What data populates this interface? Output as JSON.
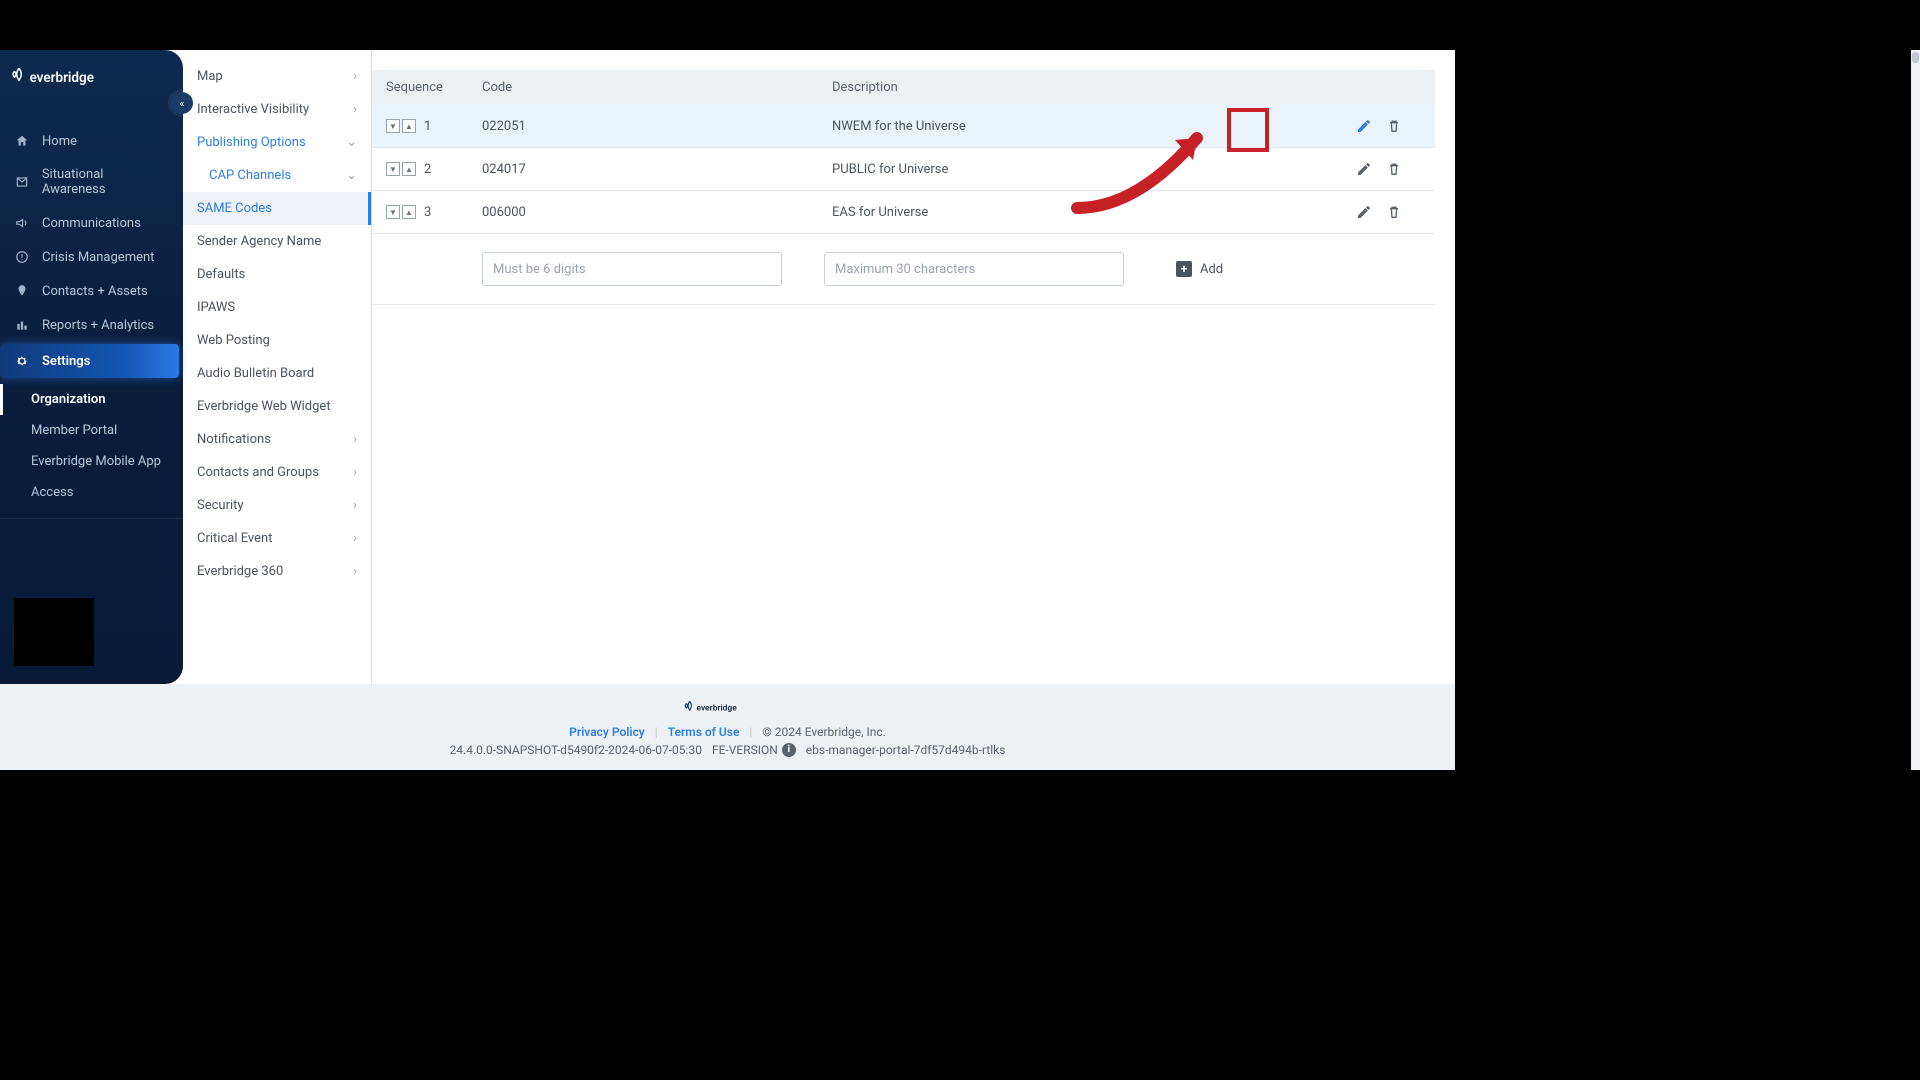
{
  "brand": "everbridge",
  "sidebar": {
    "items": [
      {
        "label": "Home"
      },
      {
        "label": "Situational Awareness"
      },
      {
        "label": "Communications"
      },
      {
        "label": "Crisis Management"
      },
      {
        "label": "Contacts + Assets"
      },
      {
        "label": "Reports + Analytics"
      },
      {
        "label": "Settings"
      }
    ],
    "sub": [
      {
        "label": "Organization"
      },
      {
        "label": "Member Portal"
      },
      {
        "label": "Everbridge Mobile App"
      },
      {
        "label": "Access"
      }
    ]
  },
  "sidebar2": {
    "items": [
      {
        "label": "Map",
        "expand": "right"
      },
      {
        "label": "Interactive Visibility",
        "expand": "right"
      },
      {
        "label": "Publishing Options",
        "expand": "down",
        "sel": true
      },
      {
        "label": "CAP Channels",
        "expand": "down",
        "sel": true,
        "indent": 1
      },
      {
        "label": "SAME Codes",
        "leaf": true,
        "active": true,
        "indent": 2
      },
      {
        "label": "Sender Agency Name",
        "leaf": true,
        "indent": 2
      },
      {
        "label": "Defaults",
        "leaf": true,
        "indent": 2
      },
      {
        "label": "IPAWS",
        "leaf": true,
        "indent": 2
      },
      {
        "label": "Web Posting",
        "leaf": true,
        "indent": 1
      },
      {
        "label": "Audio Bulletin Board",
        "leaf": true,
        "indent": 1
      },
      {
        "label": "Everbridge Web Widget",
        "leaf": true,
        "indent": 1
      },
      {
        "label": "Notifications",
        "expand": "right"
      },
      {
        "label": "Contacts and Groups",
        "expand": "right"
      },
      {
        "label": "Security",
        "expand": "right"
      },
      {
        "label": "Critical Event",
        "expand": "right"
      },
      {
        "label": "Everbridge 360",
        "expand": "right"
      }
    ]
  },
  "table": {
    "headers": {
      "seq": "Sequence",
      "code": "Code",
      "desc": "Description"
    },
    "rows": [
      {
        "seq": "1",
        "code": "022051",
        "desc": "NWEM for the Universe",
        "hl": true
      },
      {
        "seq": "2",
        "code": "024017",
        "desc": "PUBLIC for Universe"
      },
      {
        "seq": "3",
        "code": "006000",
        "desc": "EAS for Universe"
      }
    ],
    "code_placeholder": "Must be 6 digits",
    "desc_placeholder": "Maximum 30 characters",
    "add_label": "Add"
  },
  "footer": {
    "privacy": "Privacy Policy",
    "terms": "Terms of Use",
    "copyright": "© 2024 Everbridge, Inc.",
    "build": "24.4.0.0-SNAPSHOT-d5490f2-2024-06-07-05:30",
    "fe": "FE-VERSION",
    "host": "ebs-manager-portal-7df57d494b-rtlks"
  },
  "colors": {
    "accent": "#2d7fe0",
    "annot": "#c52127"
  }
}
